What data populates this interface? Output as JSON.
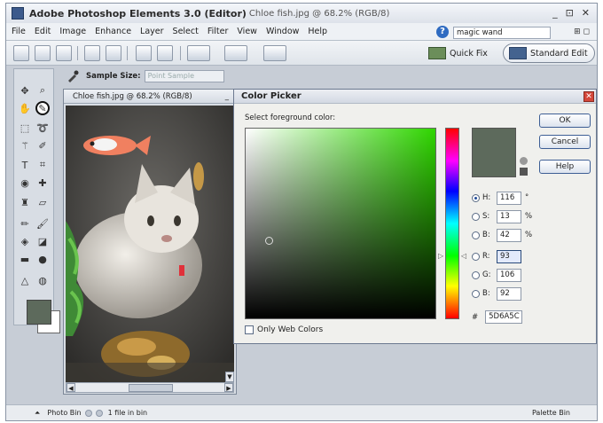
{
  "window": {
    "app_title": "Adobe Photoshop Elements 3.0 (Editor)",
    "doc_title": "Chloe fish.jpg @ 68.2% (RGB/8)",
    "controls": [
      "_",
      "⊡",
      "✕"
    ]
  },
  "menubar": {
    "items": [
      "File",
      "Edit",
      "Image",
      "Enhance",
      "Layer",
      "Select",
      "Filter",
      "View",
      "Window",
      "Help"
    ],
    "help_search_value": "magic wand"
  },
  "toolbar": {
    "quick_fix_label": "Quick Fix",
    "standard_edit_label": "Standard Edit"
  },
  "options_bar": {
    "sample_size_label": "Sample Size:",
    "sample_size_value": "Point Sample"
  },
  "document": {
    "title": "Chloe fish.jpg @ 68.2% (RGB/8)"
  },
  "color_picker": {
    "title": "Color Picker",
    "prompt": "Select foreground color:",
    "buttons": {
      "ok": "OK",
      "cancel": "Cancel",
      "help": "Help"
    },
    "fields": {
      "H": {
        "label": "H:",
        "value": "116",
        "unit": "°",
        "checked": true
      },
      "S": {
        "label": "S:",
        "value": "13",
        "unit": "%",
        "checked": false
      },
      "B": {
        "label": "B:",
        "value": "42",
        "unit": "%",
        "checked": false
      },
      "R": {
        "label": "R:",
        "value": "93",
        "unit": "",
        "checked": false
      },
      "G": {
        "label": "G:",
        "value": "106",
        "unit": "",
        "checked": false
      },
      "Bl": {
        "label": "B:",
        "value": "92",
        "unit": "",
        "checked": false
      }
    },
    "hex_symbol": "#",
    "hex_value": "5D6A5C",
    "only_web_colors": "Only Web Colors",
    "selected_color": "#5d6a5c"
  },
  "statusbar": {
    "photo_bin": "Photo Bin",
    "file_count": "1 file in bin",
    "palette_bin": "Palette Bin"
  },
  "colors": {
    "foreground": "#5d6a5c",
    "background": "#ffffff",
    "accent_blue": "#2f6bc1"
  }
}
